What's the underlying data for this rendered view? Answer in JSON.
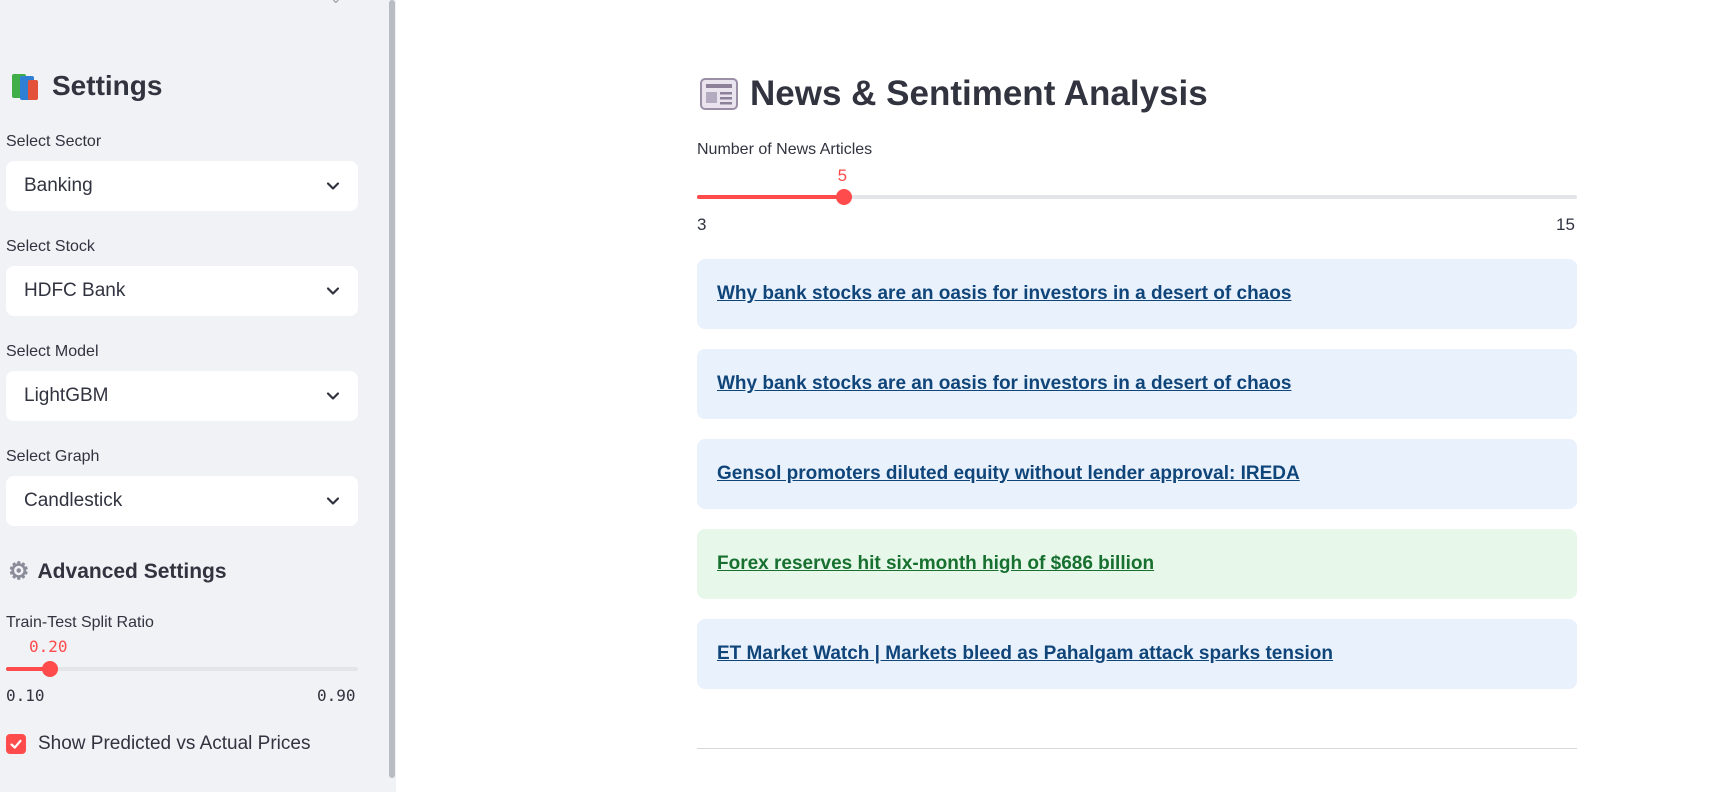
{
  "sidebar": {
    "title": "Settings",
    "selects": [
      {
        "label": "Select Sector",
        "value": "Banking"
      },
      {
        "label": "Select Stock",
        "value": "HDFC Bank"
      },
      {
        "label": "Select Model",
        "value": "LightGBM"
      },
      {
        "label": "Select Graph",
        "value": "Candlestick"
      }
    ],
    "advanced_title": "Advanced Settings",
    "split_slider": {
      "label": "Train-Test Split Ratio",
      "value": "0.20",
      "min": "0.10",
      "max": "0.90",
      "value_num": 0.2,
      "min_num": 0.1,
      "max_num": 0.9
    },
    "checkbox": {
      "label": "Show Predicted vs Actual Prices",
      "checked": true
    }
  },
  "main": {
    "title": "News & Sentiment Analysis",
    "news_slider": {
      "label": "Number of News Articles",
      "value": "5",
      "min": "3",
      "max": "15",
      "value_num": 5,
      "min_num": 3,
      "max_num": 15
    },
    "articles": [
      {
        "title": "Why bank stocks are an oasis for investors in a desert of chaos",
        "sentiment": "neutral"
      },
      {
        "title": "Why bank stocks are an oasis for investors in a desert of chaos",
        "sentiment": "neutral"
      },
      {
        "title": "Gensol promoters diluted equity without lender approval: IREDA",
        "sentiment": "neutral"
      },
      {
        "title": "Forex reserves hit six-month high of $686 billion",
        "sentiment": "positive"
      },
      {
        "title": "ET Market Watch | Markets bleed as Pahalgam attack sparks tension",
        "sentiment": "neutral"
      }
    ]
  },
  "colors": {
    "accent": "#ff4b4b",
    "sidebar_bg": "#f0f2f6",
    "neutral_card": "#e8f1fc",
    "positive_card": "#e7f8ea"
  }
}
